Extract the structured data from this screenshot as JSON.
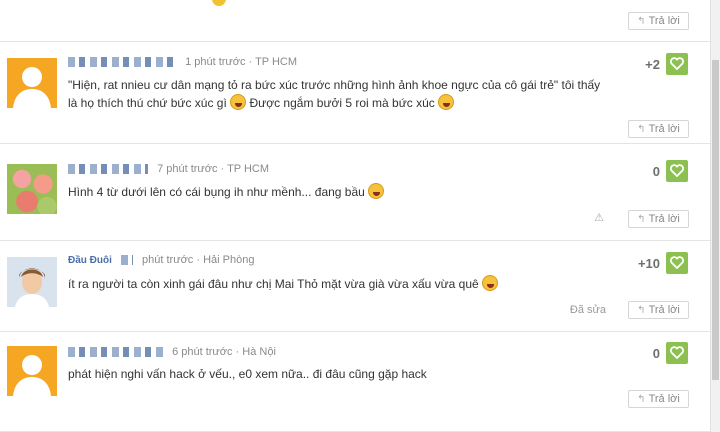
{
  "reply_label": "Trả lời",
  "edited_label": "Đã sửa",
  "comments": [
    {
      "time": "1 phút trước",
      "location": "TP HCM",
      "score": "+2",
      "text_before": "\"Hiện, rat nnieu cư dân mạng tỏ ra bức xúc trước những hình ảnh khoe ngực của cô gái trẻ\" tôi thấy là họ thích thú chứ bức xúc gì",
      "text_mid": "Được ngắm bưởi 5 roi mà bức xúc",
      "avatar": "default-user-icon"
    },
    {
      "time": "7 phút trước",
      "location": "TP HCM",
      "score": "0",
      "text_before": "Hình 4 từ dưới lên có cái bụng ih như mềnh... đang bầu",
      "avatar": "flower-photo"
    },
    {
      "name": "Đầu Đuôi",
      "time": "phút trước",
      "location": "Hải Phòng",
      "score": "+10",
      "text_before": "ít ra người ta còn xinh gái đâu như chị Mai Thỏ mặt vừa già vừa xấu vừa quê",
      "avatar": "user-photo"
    },
    {
      "time": "6 phút trước",
      "location": "Hà Nội",
      "score": "0",
      "text_before": "phát hiện nghi vấn hack ở vếu., e0 xem nữa.. đi đâu cũng gặp hack",
      "avatar": "default-user-icon"
    }
  ],
  "colors": {
    "like": "#8cc152",
    "avatar_default": "#f5a623",
    "name": "#4a6ea9"
  }
}
